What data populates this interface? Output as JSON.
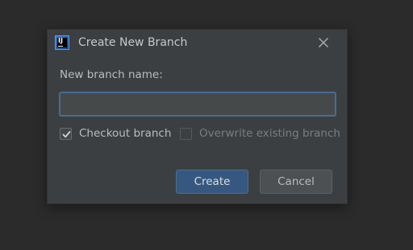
{
  "dialog": {
    "title": "Create New Branch",
    "app_icon": "intellij-idea-icon",
    "close_icon": "close-icon"
  },
  "form": {
    "name_label": "New branch name:",
    "name_value": "",
    "name_placeholder": "",
    "checkout_label": "Checkout branch",
    "checkout_checked": true,
    "overwrite_label": "Overwrite existing branch",
    "overwrite_checked": false,
    "overwrite_enabled": false
  },
  "buttons": {
    "create_label": "Create",
    "cancel_label": "Cancel"
  },
  "colors": {
    "background": "#2b2b2b",
    "dialog": "#3c3f41",
    "input_focus_border": "#466d94",
    "primary_button": "#365880"
  }
}
